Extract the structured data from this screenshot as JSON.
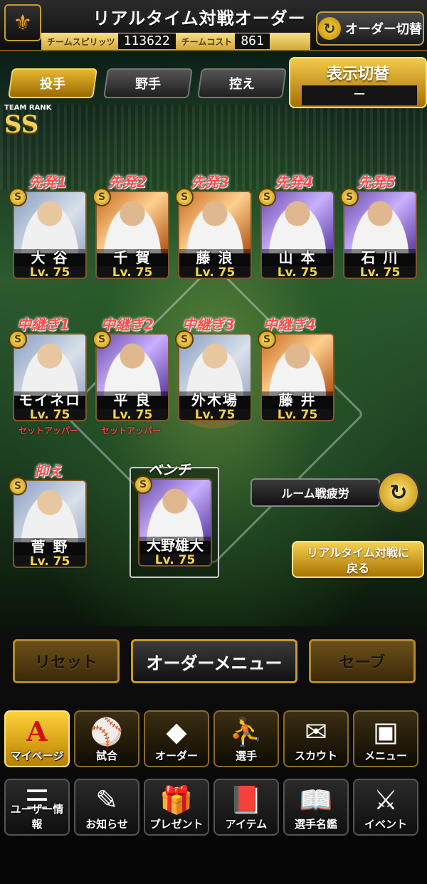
{
  "header": {
    "title": "リアルタイム対戦オーダー",
    "team_spirit_label": "チームスピリッツ",
    "team_spirit_value": "113622",
    "team_cost_label": "チームコスト",
    "team_cost_value": "861",
    "order_switch_label": "オーダー切替",
    "logo_icon": "giants-logo-icon"
  },
  "tabs": [
    {
      "label": "投手",
      "active": true
    },
    {
      "label": "野手",
      "active": false
    },
    {
      "label": "控え",
      "active": false
    }
  ],
  "display_switch": {
    "label": "表示切替",
    "value": "ー"
  },
  "team_rank": {
    "label": "TEAM RANK",
    "value": "SS"
  },
  "starters": [
    {
      "slot": "先発1",
      "name": "大 谷",
      "level": "Lv. 75"
    },
    {
      "slot": "先発2",
      "name": "千 賀",
      "level": "Lv. 75"
    },
    {
      "slot": "先発3",
      "name": "藤 浪",
      "level": "Lv. 75"
    },
    {
      "slot": "先発4",
      "name": "山 本",
      "level": "Lv. 75"
    },
    {
      "slot": "先発5",
      "name": "石 川",
      "level": "Lv. 75"
    }
  ],
  "relievers": [
    {
      "slot": "中継ぎ1",
      "name": "モイネロ",
      "level": "Lv. 75",
      "note": "セットアッパー"
    },
    {
      "slot": "中継ぎ2",
      "name": "平 良",
      "level": "Lv. 75",
      "note": "セットアッパー"
    },
    {
      "slot": "中継ぎ3",
      "name": "外木場",
      "level": "Lv. 75",
      "note": ""
    },
    {
      "slot": "中継ぎ4",
      "name": "藤 井",
      "level": "Lv. 75",
      "note": ""
    }
  ],
  "closer": {
    "slot": "抑え",
    "name": "菅 野",
    "level": "Lv. 75"
  },
  "bench": {
    "slot": "ベンチ",
    "name": "大野雄大",
    "level": "Lv. 75"
  },
  "badge_text": "S",
  "room_fatigue_label": "ルーム戦疲労",
  "back_button_label": "リアルタイム対戦に戻る",
  "back_button_line1": "リアルタイム対戦に",
  "back_button_line2": "戻る",
  "actions": {
    "reset": "リセット",
    "order_menu": "オーダーメニュー",
    "save": "セーブ"
  },
  "menu_row1": [
    {
      "label": "マイページ",
      "icon": "A"
    },
    {
      "label": "試合",
      "icon": "⚾"
    },
    {
      "label": "オーダー",
      "icon": "◆"
    },
    {
      "label": "選手",
      "icon": "⛹"
    },
    {
      "label": "スカウト",
      "icon": "✉"
    },
    {
      "label": "メニュー",
      "icon": "▣"
    }
  ],
  "menu_row2": [
    {
      "label": "ユーザー情報",
      "icon": "☰"
    },
    {
      "label": "お知らせ",
      "icon": "✎"
    },
    {
      "label": "プレゼント",
      "icon": "🎁"
    },
    {
      "label": "アイテム",
      "icon": "📕"
    },
    {
      "label": "選手名鑑",
      "icon": "📖"
    },
    {
      "label": "イベント",
      "icon": "⚔"
    }
  ],
  "colors": {
    "gold": "#d4a83a",
    "slot_label_red": "#ff4c4c",
    "level_yellow": "#f5d24a"
  }
}
